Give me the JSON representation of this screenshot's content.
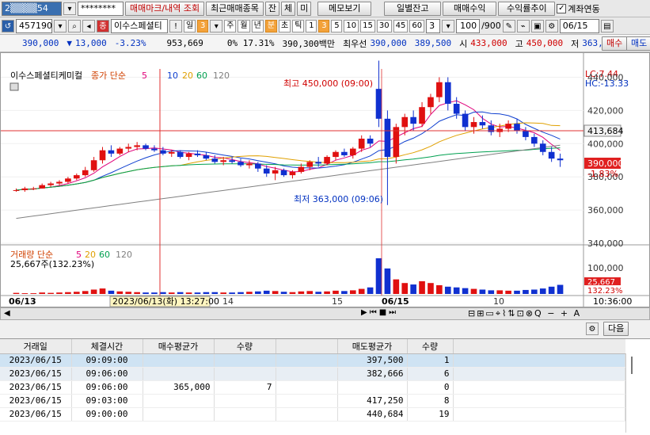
{
  "toolbar1": {
    "account": "2▒▒▒▒54",
    "password": "********",
    "buttons": [
      "매매마크/내역 조회",
      "최근매매종목",
      "잔",
      "체",
      "미",
      "메모보기",
      "일별잔고",
      "매매수익",
      "수익률추이"
    ],
    "linked_label": "계좌연동"
  },
  "toolbar2": {
    "code": "457190",
    "name": "이수스페셜티",
    "period": [
      "일",
      "주",
      "월",
      "년",
      "분",
      "초",
      "틱"
    ],
    "period_num": "3",
    "intervals": [
      "1",
      "3",
      "5",
      "10",
      "15",
      "30",
      "45",
      "60"
    ],
    "interval_sel": "3",
    "count": "100",
    "count_max": "/900",
    "date_label": "06/15"
  },
  "info": {
    "price": "390,000",
    "arrow": "▼",
    "change": "13,000",
    "rate": "-3.23%",
    "volume": "953,669",
    "turnover": "0% 17.31%",
    "amount": "390,300백만",
    "best_label": "최우선",
    "bid1": "390,000",
    "bid2": "389,500",
    "open_label": "시",
    "open": "433,000",
    "high_label": "고",
    "high": "450,000",
    "low_label": "저",
    "low": "363,000",
    "buy": "매수",
    "sell": "매도"
  },
  "chart": {
    "legend_name": "이수스페셜티케미컬",
    "legend_ma": "종가 단순",
    "ma_periods": [
      "5",
      "10",
      "20",
      "60",
      "120"
    ],
    "ma_colors": [
      "#e0007a",
      "#1040d0",
      "#e0a000",
      "#00a050",
      "#808080"
    ],
    "lc": "LC:7.44",
    "hc": "HC:-13.33",
    "high_note": "최고 450,000 (09:00)",
    "low_note": "최저 363,000 (09:06)",
    "price_ticks": [
      "440,000",
      "420,000",
      "400,000",
      "380,000",
      "360,000",
      "340,000"
    ],
    "cross_price": "413,684",
    "cur_price": "390,000",
    "cur_rate": "-1.83%",
    "vol_legend": "거래량 단순",
    "vol_ma": [
      "5",
      "20",
      "60",
      "120"
    ],
    "vol_value": "25,667주(132.23%)",
    "vol_tick": "100,000",
    "vol_cur": "25,667",
    "vol_cur_rate": "132.23%",
    "x_labels": [
      "06/13",
      "14",
      "15",
      "06/15",
      "10"
    ],
    "cursor_time": "2023/06/13(화) 13:27:00",
    "right_time": "10:36:00",
    "gear": "다음"
  },
  "chart_data": {
    "type": "candlestick",
    "y_axis": [
      340000,
      445000
    ],
    "candles": [
      [
        372,
        373,
        371,
        372
      ],
      [
        372,
        374,
        371,
        373
      ],
      [
        373,
        374,
        372,
        373
      ],
      [
        373,
        376,
        373,
        375
      ],
      [
        375,
        377,
        374,
        376
      ],
      [
        376,
        378,
        375,
        377
      ],
      [
        377,
        380,
        376,
        379
      ],
      [
        379,
        382,
        378,
        381
      ],
      [
        381,
        386,
        380,
        384
      ],
      [
        384,
        392,
        383,
        390
      ],
      [
        390,
        398,
        388,
        396
      ],
      [
        396,
        399,
        392,
        394
      ],
      [
        394,
        398,
        393,
        397
      ],
      [
        397,
        400,
        395,
        398
      ],
      [
        398,
        401,
        396,
        399
      ],
      [
        399,
        400,
        396,
        397
      ],
      [
        397,
        399,
        395,
        396
      ],
      [
        396,
        398,
        393,
        394
      ],
      [
        394,
        396,
        392,
        395
      ],
      [
        395,
        396,
        391,
        392
      ],
      [
        392,
        395,
        390,
        394
      ],
      [
        394,
        396,
        392,
        393
      ],
      [
        393,
        395,
        390,
        391
      ],
      [
        391,
        393,
        388,
        389
      ],
      [
        389,
        392,
        387,
        390
      ],
      [
        390,
        392,
        388,
        389
      ],
      [
        389,
        391,
        386,
        387
      ],
      [
        387,
        390,
        385,
        388
      ],
      [
        388,
        389,
        383,
        385
      ],
      [
        385,
        387,
        380,
        382
      ],
      [
        382,
        386,
        378,
        384
      ],
      [
        384,
        385,
        380,
        381
      ],
      [
        381,
        384,
        379,
        383
      ],
      [
        383,
        388,
        382,
        386
      ],
      [
        386,
        390,
        384,
        389
      ],
      [
        389,
        392,
        386,
        388
      ],
      [
        388,
        393,
        387,
        392
      ],
      [
        392,
        396,
        390,
        395
      ],
      [
        395,
        397,
        392,
        393
      ],
      [
        393,
        398,
        391,
        397
      ],
      [
        397,
        405,
        395,
        403
      ],
      [
        403,
        405,
        398,
        400
      ],
      [
        433,
        450,
        410,
        415
      ],
      [
        415,
        420,
        363,
        392
      ],
      [
        392,
        412,
        388,
        410
      ],
      [
        410,
        418,
        405,
        416
      ],
      [
        416,
        420,
        408,
        412
      ],
      [
        412,
        425,
        410,
        422
      ],
      [
        422,
        430,
        418,
        428
      ],
      [
        428,
        440,
        425,
        437
      ],
      [
        437,
        440,
        420,
        424
      ],
      [
        424,
        428,
        415,
        418
      ],
      [
        418,
        420,
        408,
        410
      ],
      [
        410,
        416,
        406,
        413
      ],
      [
        413,
        417,
        409,
        411
      ],
      [
        411,
        414,
        405,
        407
      ],
      [
        407,
        412,
        404,
        409
      ],
      [
        409,
        414,
        407,
        412
      ],
      [
        412,
        415,
        406,
        408
      ],
      [
        408,
        410,
        402,
        404
      ],
      [
        404,
        406,
        398,
        400
      ],
      [
        400,
        402,
        393,
        395
      ],
      [
        395,
        398,
        389,
        391
      ],
      [
        391,
        394,
        386,
        390
      ]
    ],
    "volumes": [
      3,
      2,
      2,
      4,
      3,
      4,
      5,
      6,
      8,
      12,
      15,
      9,
      7,
      6,
      5,
      4,
      4,
      5,
      4,
      5,
      4,
      4,
      5,
      5,
      4,
      4,
      5,
      6,
      7,
      9,
      8,
      6,
      5,
      7,
      8,
      6,
      7,
      9,
      8,
      10,
      14,
      18,
      98,
      70,
      40,
      30,
      26,
      35,
      30,
      24,
      20,
      18,
      16,
      14,
      12,
      10,
      10,
      9,
      9,
      11,
      12,
      15,
      20,
      25
    ]
  },
  "grid": {
    "headers": [
      "거래일",
      "체결시간",
      "매수평균가",
      "수량",
      "",
      "매도평균가",
      "수량"
    ],
    "rows": [
      [
        "2023/06/15",
        "09:09:00",
        "",
        "",
        "",
        "397,500",
        "1"
      ],
      [
        "2023/06/15",
        "09:06:00",
        "",
        "",
        "",
        "382,666",
        "6"
      ],
      [
        "2023/06/15",
        "09:06:00",
        "365,000",
        "7",
        "",
        "",
        "0"
      ],
      [
        "2023/06/15",
        "09:03:00",
        "",
        "",
        "",
        "417,250",
        "8"
      ],
      [
        "2023/06/15",
        "09:00:00",
        "",
        "",
        "",
        "440,684",
        "19"
      ]
    ]
  }
}
